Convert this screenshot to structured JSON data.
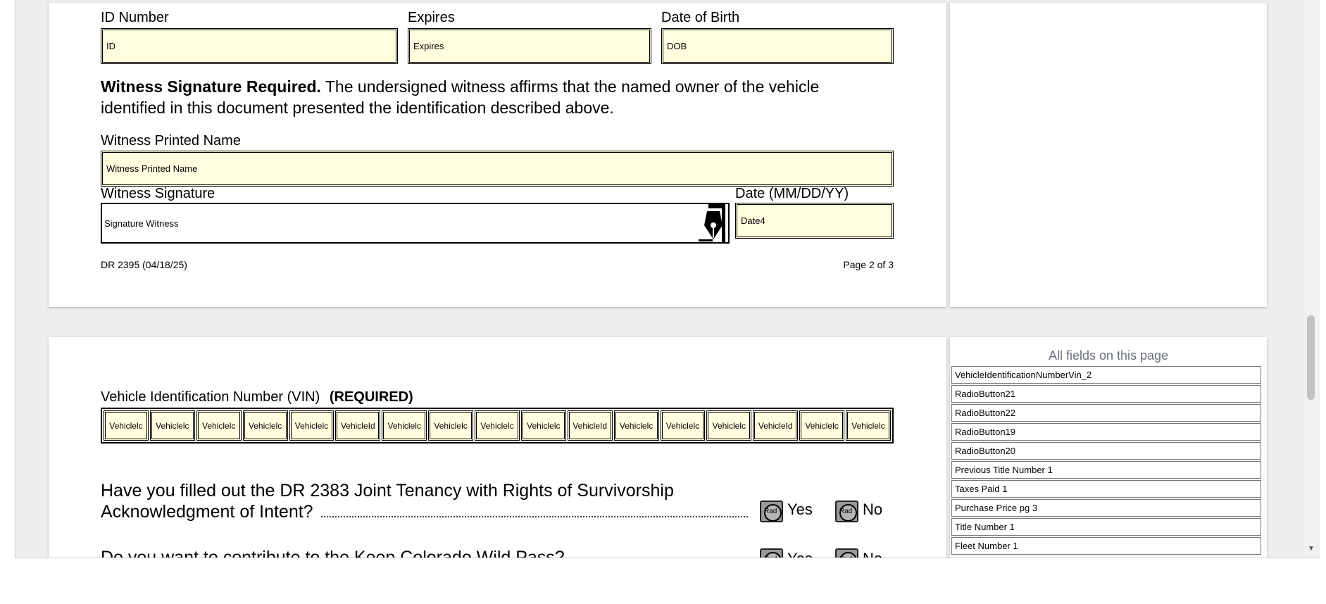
{
  "page2": {
    "id_label": "ID Number",
    "id_value": "ID",
    "expires_label": "Expires",
    "expires_value": "Expires",
    "dob_label": "Date of Birth",
    "dob_value": "DOB",
    "witness_bold": "Witness Signature Required.",
    "witness_text_1": " The undersigned witness affirms that the named owner of the vehicle",
    "witness_text_2": "identified in this document presented the identification described above.",
    "printed_name_label": "Witness Printed Name",
    "printed_name_value": "Witness Printed Name",
    "signature_label": "Witness Signature",
    "signature_value": "Signature  Witness",
    "date_label": "Date (MM/DD/YY)",
    "date_value": "Date4",
    "form_number": "DR 2395 (04/18/25)",
    "page_number": "Page 2 of 3"
  },
  "page3": {
    "vin_label": "Vehicle Identification Number (VIN)",
    "vin_required": "(REQUIRED)",
    "vin_cells": [
      "Vehiclelc",
      "Vehiclelc",
      "Vehiclelc",
      "Vehiclelc",
      "Vehiclelc",
      "VehicleId",
      "Vehiclelc",
      "Vehiclelc",
      "Vehiclelc",
      "Vehiclelc",
      "VehicleId",
      "Vehiclelc",
      "Vehiclelc",
      "Vehiclelc",
      "VehicleId",
      "Vehiclelc",
      "Vehiclelc"
    ],
    "question1_line1": "Have you filled out the DR 2383 Joint Tenancy with Rights of Survivorship",
    "question1_line2": "Acknowledgment of Intent?",
    "yes_label": "Yes",
    "no_label": "No",
    "radio_text": "Rad",
    "question2_partial": "Do you want to contribute to the Keep Colorado Wild Pass?"
  },
  "sidebar": {
    "title": "All fields on this page",
    "fields": [
      "VehicleIdentificationNumberVin_2",
      "RadioButton21",
      "RadioButton22",
      "RadioButton19",
      "RadioButton20",
      "Previous Title Number 1",
      "Taxes Paid 1",
      "Purchase Price pg 3",
      "Title Number 1",
      "Fleet Number 1"
    ]
  }
}
